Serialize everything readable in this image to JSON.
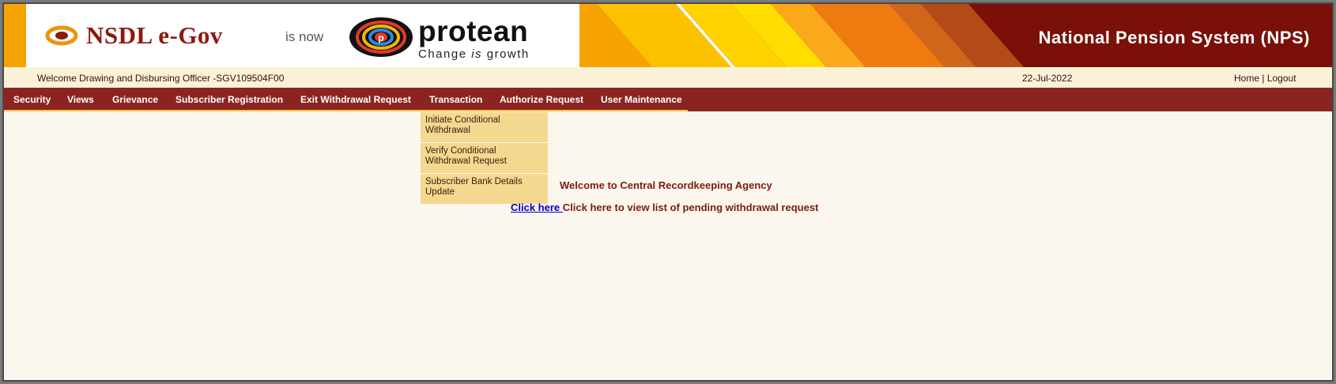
{
  "banner": {
    "brand_nsdl": "NSDL e-Gov",
    "is_now": "is now",
    "brand_protean": "protean",
    "tagline_pre": "Change",
    "tagline_is": "is",
    "tagline_post": "growth",
    "system_title": "National Pension System (NPS)",
    "colors": {
      "stripe_orange": "#f5a300",
      "stripe_yellow": "#ffd200",
      "dark_red": "#7a1008"
    }
  },
  "infobar": {
    "welcome": "Welcome Drawing and Disbursing Officer -SGV109504F00",
    "date": "22-Jul-2022",
    "home": "Home",
    "separator": "|",
    "logout": "Logout"
  },
  "nav": {
    "items": [
      "Security",
      "Views",
      "Grievance",
      "Subscriber Registration",
      "Exit Withdrawal Request",
      "Transaction",
      "Authorize Request",
      "User Maintenance"
    ]
  },
  "dropdown": {
    "items": [
      "Initiate Conditional Withdrawal",
      "Verify Conditional Withdrawal Request",
      "Subscriber Bank Details Update"
    ]
  },
  "main": {
    "welcome": "Welcome to Central Recordkeeping Agency",
    "click_here": "Click here ",
    "pending_text": "Click here to view list of pending withdrawal request"
  }
}
